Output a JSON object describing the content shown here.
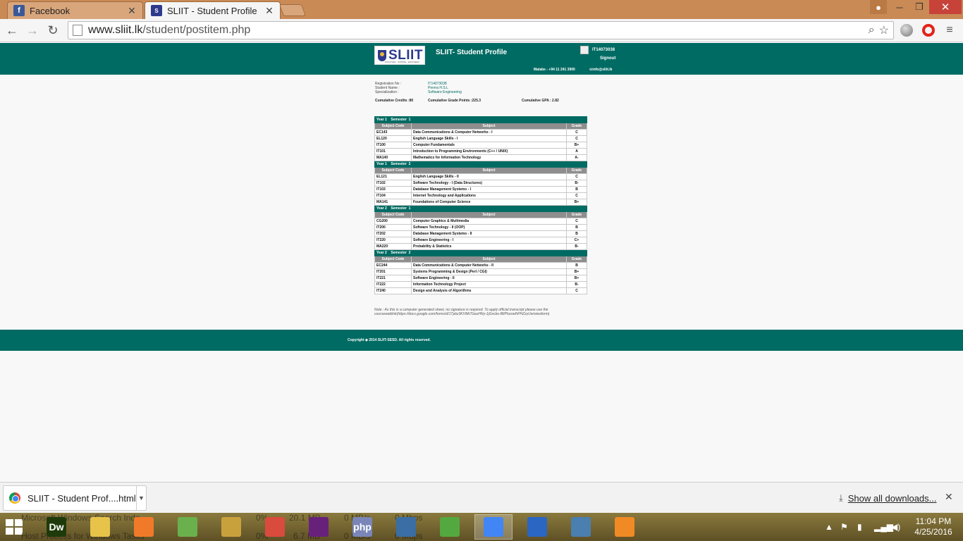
{
  "browser": {
    "tabs": [
      {
        "title": "Facebook",
        "icon": "facebook-icon"
      },
      {
        "title": "SLIIT - Student Profile",
        "icon": "sliit-icon"
      }
    ],
    "url_host": "www.sliit.lk",
    "url_path": "/student/postitem.php"
  },
  "site": {
    "logo_text": "SLIIT",
    "logo_tagline": "DISCOVER · INSPIRE · ENGINEER",
    "title": "SLIIT- Student Profile",
    "user_id": "IT14073038",
    "signout": "Signout",
    "phone": "Malabe - +94 11 241 3900",
    "email": "info@sliit.lk",
    "accent_color": "#006b63"
  },
  "student": {
    "reg_label": "Registration No :",
    "reg_value": "IT14073038",
    "name_label": "Student Name :",
    "name_value": "Perera H.S.L",
    "spec_label": "Specialization :",
    "spec_value": "Software Engineering",
    "credits": "Cumulative Credits :80",
    "grade_points": "Cumulative Grade Points :225.3",
    "gpa": "Cumulative GPA : 2.82"
  },
  "table_headers": {
    "code": "Subject Code",
    "subject": "Subject",
    "grade": "Grade"
  },
  "semesters": [
    {
      "year": "Year 1",
      "semester": "Semester  1",
      "rows": [
        {
          "code": "EC143",
          "subject": "Data Communications & Computer Networks - I",
          "grade": "C"
        },
        {
          "code": "EL120",
          "subject": "English Language Skills - I",
          "grade": "C"
        },
        {
          "code": "IT100",
          "subject": "Computer Fundamentals",
          "grade": "B+"
        },
        {
          "code": "IT101",
          "subject": "Introduction to Programming Environments (C++ / UNIX)",
          "grade": "A"
        },
        {
          "code": "MA140",
          "subject": "Mathematics for Information Technology",
          "grade": "A-"
        }
      ]
    },
    {
      "year": "Year 1",
      "semester": "Semester  2",
      "rows": [
        {
          "code": "EL121",
          "subject": "English Language Skills - II",
          "grade": "C"
        },
        {
          "code": "IT102",
          "subject": "Software Technology - I (Data Structures)",
          "grade": "B-"
        },
        {
          "code": "IT103",
          "subject": "Database Management Systems - I",
          "grade": "B"
        },
        {
          "code": "IT104",
          "subject": "Internet Technology and Applications",
          "grade": "C"
        },
        {
          "code": "MA141",
          "subject": "Foundations of Computer Science",
          "grade": "B+"
        }
      ]
    },
    {
      "year": "Year 2",
      "semester": "Semester  1",
      "rows": [
        {
          "code": "CG200",
          "subject": "Computer Graphics & Multimedia",
          "grade": "C"
        },
        {
          "code": "IT200",
          "subject": "Software Technology - II (OOP)",
          "grade": "B"
        },
        {
          "code": "IT202",
          "subject": "Database Management Systems - II",
          "grade": "B"
        },
        {
          "code": "IT220",
          "subject": "Software Engineering - I",
          "grade": "C+"
        },
        {
          "code": "MA220",
          "subject": "Probability & Statistics",
          "grade": "B-"
        }
      ]
    },
    {
      "year": "Year 2",
      "semester": "Semester  2",
      "rows": [
        {
          "code": "EC244",
          "subject": "Data Communications & Computer Networks - II",
          "grade": "B"
        },
        {
          "code": "IT201",
          "subject": "Systems Programming & Design (Perl / CGI)",
          "grade": "B+"
        },
        {
          "code": "IT221",
          "subject": "Software Engineering - II",
          "grade": "B+"
        },
        {
          "code": "IT222",
          "subject": "Information Technology Project",
          "grade": "B-"
        },
        {
          "code": "IT240",
          "subject": "Design and Analysis of Algorithms",
          "grade": "C"
        }
      ]
    }
  ],
  "note": "Note : As this is a computer generated sheet, no signature is required. To apply official transcript please use the courseweblink(https://docs.google.com/forms/d/1Tpbz3KV8A7GeuHNy-1jGxcbo-BlIPhzzwlhPHZzyUw/viewform)",
  "footer": "Copyright ◆ 2014 SLIIT-SESD. All rights reserved.",
  "downloads": {
    "item": "SLIIT - Student Prof....html",
    "show_all": "Show all downloads..."
  },
  "taskbar": {
    "ghost_lines": [
      "Microsoft Windows Search Inde",
      "Host Process for Windows Tasks"
    ],
    "ghost_stats": [
      "0%",
      "20.1 MB",
      "0 MB/s",
      "0 Mbps",
      "0%",
      "6.7 MB",
      "0 MB/s",
      "0 Mbps"
    ],
    "apps": [
      {
        "name": "dreamweaver",
        "label": "Dw",
        "color": "#1e3a0a"
      },
      {
        "name": "file-explorer",
        "label": "",
        "color": "#e7c34a"
      },
      {
        "name": "xampp",
        "label": "",
        "color": "#f07a2a"
      },
      {
        "name": "android-studio",
        "label": "",
        "color": "#6ab04c"
      },
      {
        "name": "tools",
        "label": "",
        "color": "#c9a13c"
      },
      {
        "name": "git",
        "label": "",
        "color": "#d94b3d"
      },
      {
        "name": "visual-studio",
        "label": "",
        "color": "#68217a"
      },
      {
        "name": "php",
        "label": "php",
        "color": "#7a86b8"
      },
      {
        "name": "wireshark",
        "label": "",
        "color": "#3a6ea5"
      },
      {
        "name": "utorrent",
        "label": "",
        "color": "#53a93f"
      },
      {
        "name": "chrome",
        "label": "",
        "color": "#4285f4"
      },
      {
        "name": "virtualbox",
        "label": "",
        "color": "#2a66c2"
      },
      {
        "name": "task-manager",
        "label": "",
        "color": "#4a7fb0"
      },
      {
        "name": "media-player",
        "label": "",
        "color": "#f08a24"
      }
    ],
    "time": "11:04 PM",
    "date": "4/25/2016"
  }
}
